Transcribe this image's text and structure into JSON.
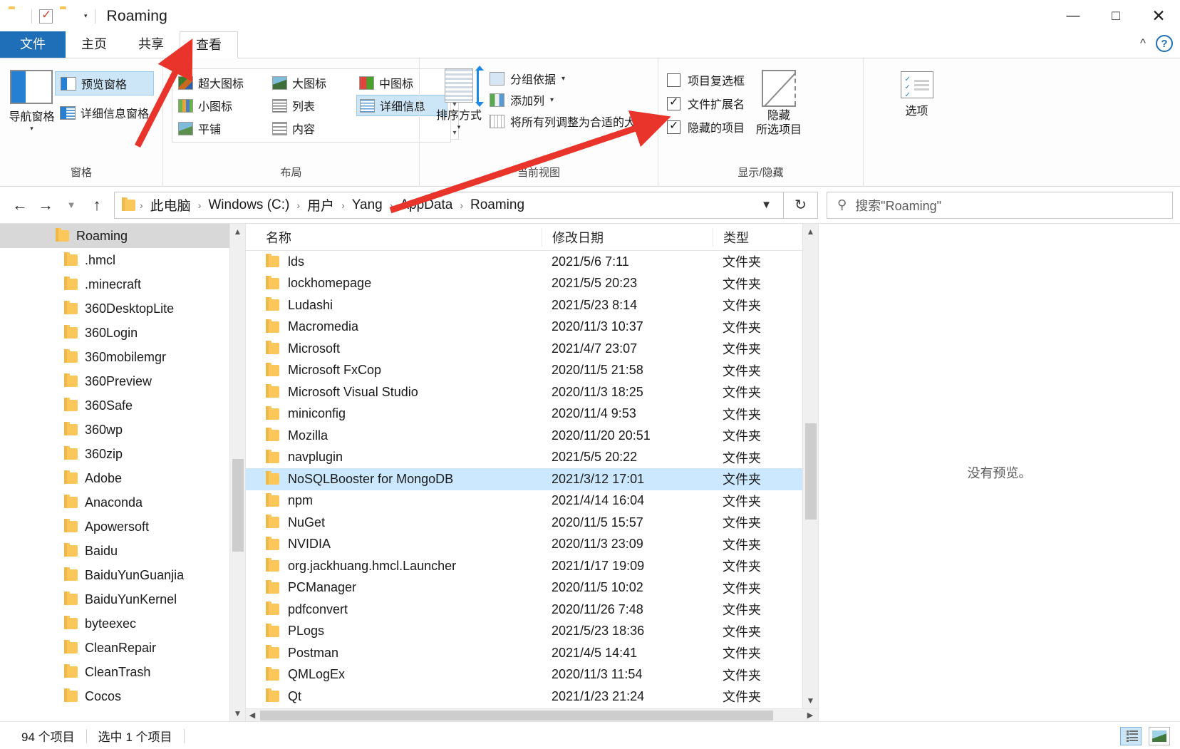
{
  "window": {
    "title": "Roaming",
    "quick_access": [
      "folder-icon",
      "properties-icon",
      "new-folder-icon",
      "customize-dropdown"
    ],
    "controls": {
      "minimize": "─",
      "maximize": "☐",
      "close": "✕"
    }
  },
  "ribbon": {
    "tabs": [
      {
        "label": "文件",
        "state": "file"
      },
      {
        "label": "主页",
        "state": "normal"
      },
      {
        "label": "共享",
        "state": "normal"
      },
      {
        "label": "查看",
        "state": "active"
      }
    ],
    "collapse_icon": "chevron-up-icon",
    "help_icon": "help-icon",
    "groups": [
      {
        "title": "窗格",
        "big_button": "导航窗格",
        "items": [
          {
            "label": "预览窗格",
            "selected": true
          },
          {
            "label": "详细信息窗格",
            "selected": false
          }
        ]
      },
      {
        "title": "布局",
        "items": [
          {
            "label": "超大图标",
            "selected": false
          },
          {
            "label": "大图标",
            "selected": false
          },
          {
            "label": "中图标",
            "selected": false
          },
          {
            "label": "小图标",
            "selected": false
          },
          {
            "label": "列表",
            "selected": false
          },
          {
            "label": "详细信息",
            "selected": true
          },
          {
            "label": "平铺",
            "selected": false
          },
          {
            "label": "内容",
            "selected": false
          }
        ]
      },
      {
        "title": "当前视图",
        "big_button": "排序方式",
        "items": [
          {
            "label": "分组依据",
            "dropdown": true
          },
          {
            "label": "添加列",
            "dropdown": true
          },
          {
            "label": "将所有列调整为合适的大小",
            "dropdown": false
          }
        ]
      },
      {
        "title": "显示/隐藏",
        "checkboxes": [
          {
            "label": "项目复选框",
            "checked": false
          },
          {
            "label": "文件扩展名",
            "checked": true
          },
          {
            "label": "隐藏的项目",
            "checked": true
          }
        ],
        "hide_button": {
          "line1": "隐藏",
          "line2": "所选项目"
        }
      },
      {
        "title": "",
        "options_button": "选项"
      }
    ]
  },
  "address": {
    "back_icon": "back-arrow-icon",
    "forward_icon": "forward-arrow-icon",
    "recent_icon": "chevron-down-icon",
    "up_icon": "up-arrow-icon",
    "breadcrumbs": [
      "此电脑",
      "Windows (C:)",
      "用户",
      "Yang",
      "AppData",
      "Roaming"
    ],
    "dropdown_icon": "chevron-down-icon",
    "refresh_icon": "refresh-icon",
    "search_icon": "search-icon",
    "search_placeholder": "搜索\"Roaming\""
  },
  "navpane": {
    "items": [
      {
        "label": "Roaming",
        "selected": true
      },
      {
        "label": ".hmcl",
        "selected": false
      },
      {
        "label": ".minecraft",
        "selected": false
      },
      {
        "label": "360DesktopLite",
        "selected": false
      },
      {
        "label": "360Login",
        "selected": false
      },
      {
        "label": "360mobilemgr",
        "selected": false
      },
      {
        "label": "360Preview",
        "selected": false
      },
      {
        "label": "360Safe",
        "selected": false
      },
      {
        "label": "360wp",
        "selected": false
      },
      {
        "label": "360zip",
        "selected": false
      },
      {
        "label": "Adobe",
        "selected": false
      },
      {
        "label": "Anaconda",
        "selected": false
      },
      {
        "label": "Apowersoft",
        "selected": false
      },
      {
        "label": "Baidu",
        "selected": false
      },
      {
        "label": "BaiduYunGuanjia",
        "selected": false
      },
      {
        "label": "BaiduYunKernel",
        "selected": false
      },
      {
        "label": "byteexec",
        "selected": false
      },
      {
        "label": "CleanRepair",
        "selected": false
      },
      {
        "label": "CleanTrash",
        "selected": false
      },
      {
        "label": "Cocos",
        "selected": false
      }
    ]
  },
  "filelist": {
    "columns": [
      "名称",
      "修改日期",
      "类型"
    ],
    "sort_indicator": "sort-ascending-icon",
    "rows": [
      {
        "name": "lds",
        "date": "2021/5/6 7:11",
        "type": "文件夹",
        "selected": false
      },
      {
        "name": "lockhomepage",
        "date": "2021/5/5 20:23",
        "type": "文件夹",
        "selected": false
      },
      {
        "name": "Ludashi",
        "date": "2021/5/23 8:14",
        "type": "文件夹",
        "selected": false
      },
      {
        "name": "Macromedia",
        "date": "2020/11/3 10:37",
        "type": "文件夹",
        "selected": false
      },
      {
        "name": "Microsoft",
        "date": "2021/4/7 23:07",
        "type": "文件夹",
        "selected": false
      },
      {
        "name": "Microsoft FxCop",
        "date": "2020/11/5 21:58",
        "type": "文件夹",
        "selected": false
      },
      {
        "name": "Microsoft Visual Studio",
        "date": "2020/11/3 18:25",
        "type": "文件夹",
        "selected": false
      },
      {
        "name": "miniconfig",
        "date": "2020/11/4 9:53",
        "type": "文件夹",
        "selected": false
      },
      {
        "name": "Mozilla",
        "date": "2020/11/20 20:51",
        "type": "文件夹",
        "selected": false
      },
      {
        "name": "navplugin",
        "date": "2021/5/5 20:22",
        "type": "文件夹",
        "selected": false
      },
      {
        "name": "NoSQLBooster for MongoDB",
        "date": "2021/3/12 17:01",
        "type": "文件夹",
        "selected": true
      },
      {
        "name": "npm",
        "date": "2021/4/14 16:04",
        "type": "文件夹",
        "selected": false
      },
      {
        "name": "NuGet",
        "date": "2020/11/5 15:57",
        "type": "文件夹",
        "selected": false
      },
      {
        "name": "NVIDIA",
        "date": "2020/11/3 23:09",
        "type": "文件夹",
        "selected": false
      },
      {
        "name": "org.jackhuang.hmcl.Launcher",
        "date": "2021/1/17 19:09",
        "type": "文件夹",
        "selected": false
      },
      {
        "name": "PCManager",
        "date": "2020/11/5 10:02",
        "type": "文件夹",
        "selected": false
      },
      {
        "name": "pdfconvert",
        "date": "2020/11/26 7:48",
        "type": "文件夹",
        "selected": false
      },
      {
        "name": "PLogs",
        "date": "2021/5/23 18:36",
        "type": "文件夹",
        "selected": false
      },
      {
        "name": "Postman",
        "date": "2021/4/5 14:41",
        "type": "文件夹",
        "selected": false
      },
      {
        "name": "QMLogEx",
        "date": "2020/11/3 11:54",
        "type": "文件夹",
        "selected": false
      },
      {
        "name": "Qt",
        "date": "2021/1/23 21:24",
        "type": "文件夹",
        "selected": false
      }
    ]
  },
  "preview": {
    "message": "没有预览。"
  },
  "statusbar": {
    "item_count": "94 个项目",
    "selected_count": "选中 1 个项目",
    "views": [
      {
        "name": "details-view",
        "active": true
      },
      {
        "name": "large-icons-view",
        "active": false
      }
    ]
  },
  "colors": {
    "accent": "#1e6fb8",
    "selection": "#cce8ff",
    "ribbon_selection": "#cde6f7",
    "folder": "#fcc75a",
    "annotation": "#e8342a"
  }
}
